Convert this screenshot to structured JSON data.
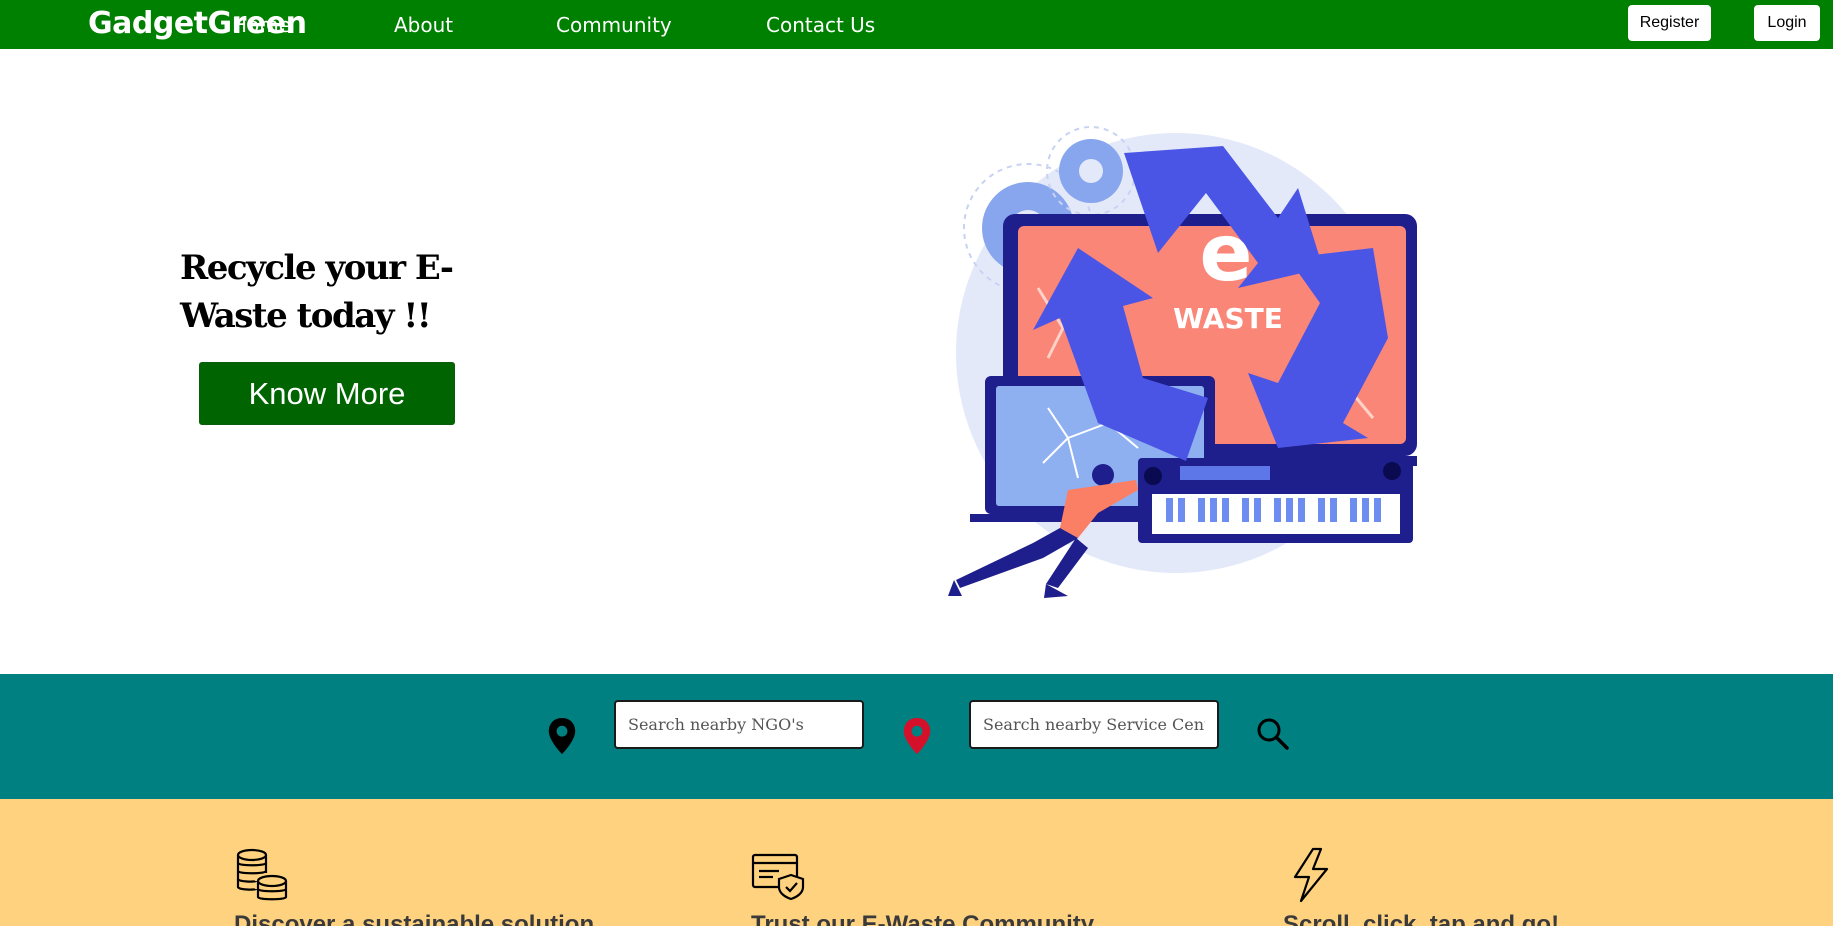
{
  "nav": {
    "brand": "GadgetGreen",
    "links": {
      "home": "Home",
      "about": "About",
      "community": "Community",
      "contact": "Contact Us"
    },
    "register": "Register",
    "login": "Login",
    "color": "#008000"
  },
  "hero": {
    "title": "Recycle your E-Waste today !!",
    "button": "Know More",
    "illustration": {
      "big_letter": "e",
      "word": "WASTE"
    }
  },
  "search": {
    "ngo_placeholder": "Search nearby NGO's",
    "service_placeholder": "Search nearby Service Centers",
    "band_color": "#008080",
    "icons": [
      "location-pin-icon",
      "location-pin-icon",
      "search-icon"
    ]
  },
  "features": [
    {
      "icon": "coins-icon",
      "text": "Discover a sustainable solution"
    },
    {
      "icon": "secure-card-icon",
      "text": "Trust our E-Waste Community"
    },
    {
      "icon": "lightning-icon",
      "text": "Scroll, click, tap and go!"
    }
  ],
  "colors": {
    "features_bg": "#ffd280",
    "button_dark_green": "#006400"
  }
}
